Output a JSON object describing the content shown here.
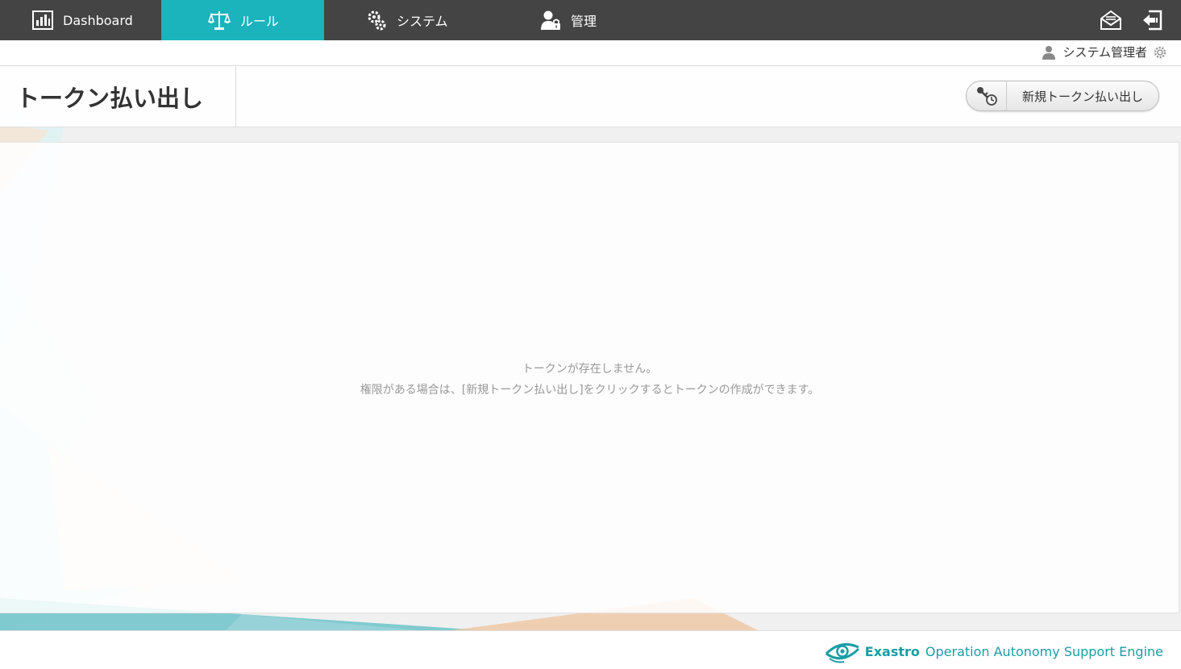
{
  "nav": {
    "items": [
      {
        "label": "Dashboard",
        "icon": "dashboard-icon",
        "active": false
      },
      {
        "label": "ルール",
        "icon": "scales-icon",
        "active": true
      },
      {
        "label": "システム",
        "icon": "gears-icon",
        "active": false
      },
      {
        "label": "管理",
        "icon": "user-lock-icon",
        "active": false
      }
    ],
    "right_icons": [
      "mail-icon",
      "logout-icon"
    ]
  },
  "userbar": {
    "user_name": "システム管理者",
    "icons": [
      "user-icon",
      "settings-gear-icon"
    ]
  },
  "page": {
    "title": "トークン払い出し",
    "new_token_button": "新規トークン払い出し",
    "new_token_icon": "key-clock-icon"
  },
  "empty_state": {
    "line1": "トークンが存在しません。",
    "line2": "権限がある場合は、[新規トークン払い出し]をクリックするとトークンの作成ができます。"
  },
  "footer": {
    "brand_bold": "Exastro",
    "brand_rest": "Operation Autonomy Support Engine",
    "logo": "exastro-eye-logo"
  },
  "colors": {
    "nav_bg": "#444444",
    "active_tab": "#1bb3bc",
    "brand_teal": "#1a9da5",
    "muted_text": "#999999"
  }
}
